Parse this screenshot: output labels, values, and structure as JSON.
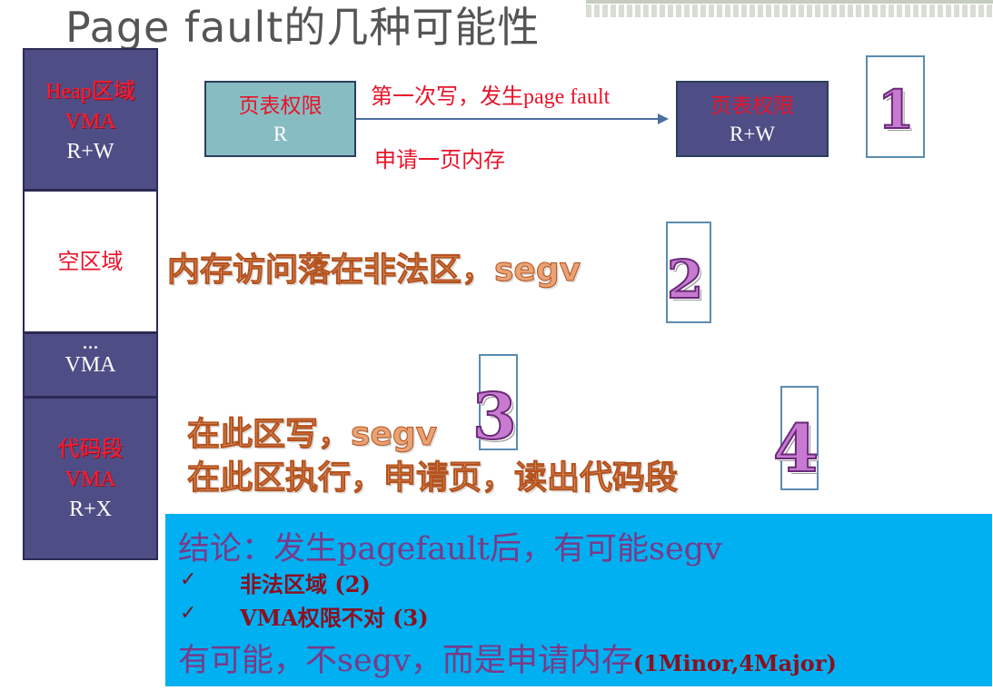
{
  "title": "Page fault的几种可能性",
  "memory": {
    "heap": {
      "line1": "Heap区域",
      "line2": "VMA",
      "line3": "R+W"
    },
    "empty": {
      "label": "空区域"
    },
    "vma": {
      "line1": "...",
      "line2": "VMA"
    },
    "code": {
      "line1": "代码段",
      "line2": "VMA",
      "line3": "R+X"
    }
  },
  "page_table_before": {
    "line1": "页表权限",
    "line2": "R"
  },
  "page_table_after": {
    "line1": "页表权限",
    "line2": "R+W"
  },
  "arrow_top_label": "第一次写，发生page fault",
  "arrow_bottom_label": "申请一页内存",
  "case1": {
    "number": "1"
  },
  "case2": {
    "number": "2",
    "text": "内存访问落在非法区，segv"
  },
  "case3": {
    "number": "3",
    "text": "在此区写，segv"
  },
  "case4": {
    "number": "4",
    "text": "在此区执行，申请页，读出代码段"
  },
  "conclusion": {
    "line1": "结论：发生pagefault后，有可能segv",
    "item1": "非法区域 (2)",
    "item2": "VMA权限不对 (3)",
    "line_last_main": "有可能，不segv，而是申请内存",
    "line_last_suffix": "(1Minor,4Major)",
    "check_symbol": "✓"
  },
  "colors": {
    "conclusion_bg": "#00b0f0",
    "vma_block": "#4f4d85",
    "page_table_r": "#86bcc2"
  }
}
